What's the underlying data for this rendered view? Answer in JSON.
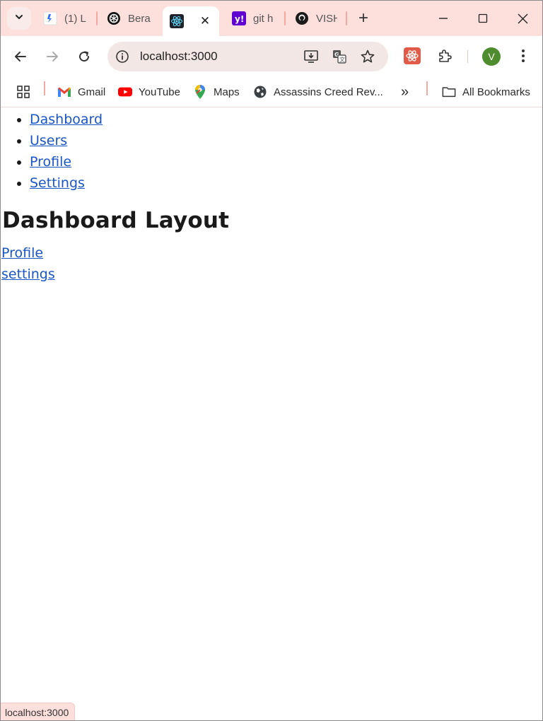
{
  "browser": {
    "tabs": [
      {
        "title": "(1) L",
        "favicon": "syncmer-icon",
        "active": false
      },
      {
        "title": "Bera",
        "favicon": "openai-icon",
        "active": false
      },
      {
        "title": "",
        "favicon": "react-icon",
        "active": true
      },
      {
        "title": "git h",
        "favicon": "yahoo-icon",
        "active": false
      },
      {
        "title": "VISH",
        "favicon": "github-icon",
        "active": false
      }
    ],
    "new_tab_symbol": "+",
    "address": "localhost:3000",
    "profile_initial": "V",
    "bookmarks": [
      {
        "label": "Gmail",
        "icon": "gmail-icon"
      },
      {
        "label": "YouTube",
        "icon": "youtube-icon"
      },
      {
        "label": "Maps",
        "icon": "maps-icon"
      },
      {
        "label": "Assassins Creed Rev...",
        "icon": "globe-icon"
      }
    ],
    "bookmarks_overflow": "»",
    "all_bookmarks_label": "All Bookmarks",
    "status_text": "localhost:3000",
    "colors": {
      "tabstrip": "#fde0dc",
      "link": "#1a55c4",
      "avatar": "#4f8c2d"
    }
  },
  "page": {
    "nav_links": [
      "Dashboard",
      "Users",
      "Profile",
      "Settings"
    ],
    "heading": "Dashboard Layout",
    "sub_links": [
      "Profile",
      "settings"
    ]
  }
}
